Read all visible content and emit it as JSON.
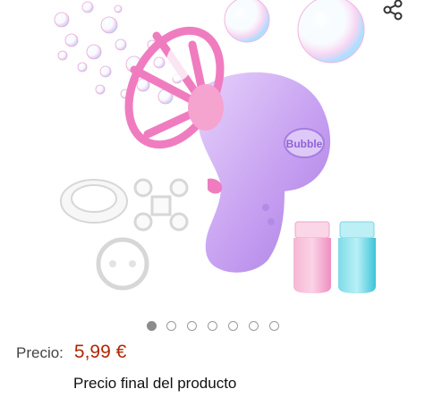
{
  "product_image": {
    "alt": "",
    "badge_text": "Bubble",
    "gallery_count": 7,
    "active_index": 0,
    "colors": {
      "gun_body": "#c9a4f2",
      "gun_pink": "#f07cc0",
      "bottle_pink": "#f5a3c9",
      "bottle_blue": "#5fd0e0"
    }
  },
  "share": {
    "icon": "share-icon"
  },
  "price": {
    "label": "Precio:",
    "value": "5,99 €",
    "color": "#b12704"
  },
  "final_note": "Precio final del producto"
}
